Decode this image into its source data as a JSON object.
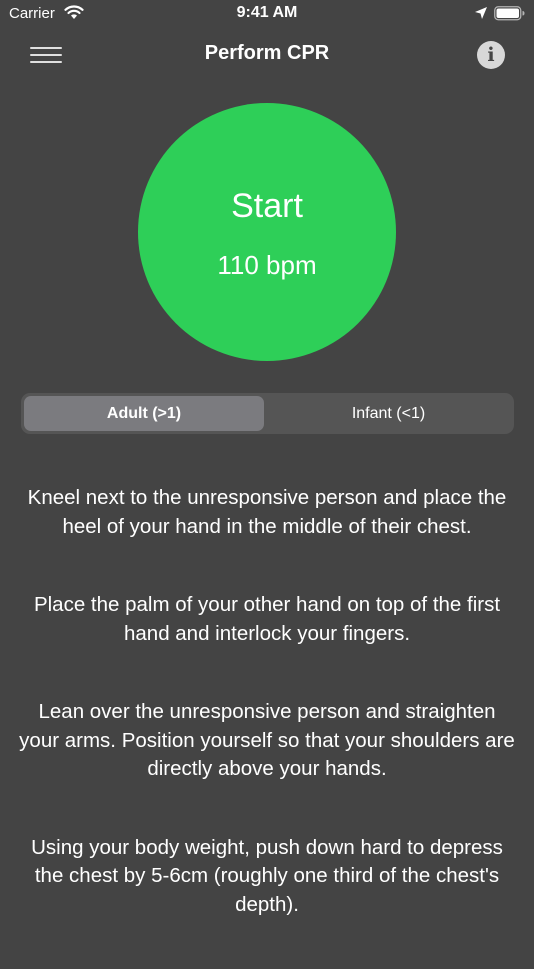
{
  "status_bar": {
    "carrier": "Carrier",
    "time": "9:41 AM",
    "icons": [
      "wifi-icon",
      "location-icon",
      "battery-icon"
    ]
  },
  "nav": {
    "title": "Perform CPR",
    "menu_icon": "hamburger-menu-icon",
    "info_icon": "info-icon",
    "info_glyph": "i"
  },
  "metronome": {
    "start_label": "Start",
    "bpm_label": "110 bpm",
    "color": "#2ECF58"
  },
  "segmented_control": {
    "options": [
      {
        "label": "Adult (>1)",
        "selected": true
      },
      {
        "label": "Infant (<1)",
        "selected": false
      }
    ]
  },
  "instructions": [
    "Kneel next to the unresponsive person and place the heel of your hand in the middle of their chest.",
    "Place the palm of your other hand on top of the first hand and interlock your fingers.",
    "Lean over the unresponsive person and straighten your arms. Position yourself so that your shoulders are directly above your hands.",
    "Using your body weight, push down hard to depress the chest by 5-6cm (roughly one third of the chest's depth)."
  ],
  "colors": {
    "background": "#444444",
    "accent_green": "#2ECF58",
    "segment_selected": "#7B7B7F",
    "segment_track": "#555555"
  }
}
